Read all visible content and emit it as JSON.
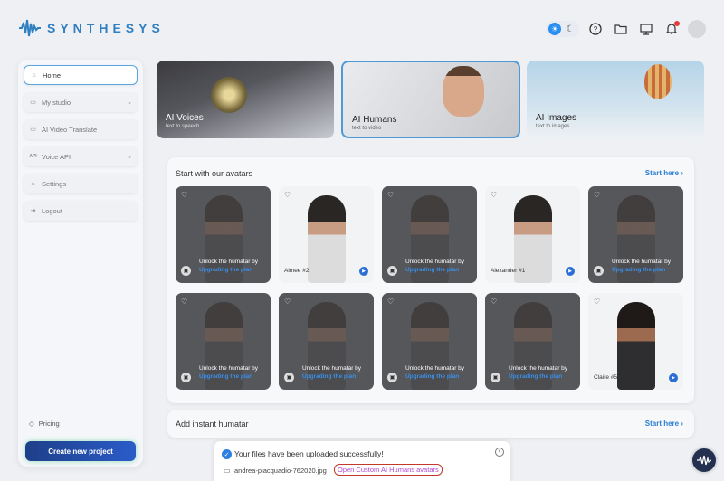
{
  "brand": {
    "name": "SYNTHESYS"
  },
  "header": {
    "icons": [
      "sun-icon",
      "moon-icon",
      "help-icon",
      "folder-icon",
      "presentation-icon",
      "bell-icon",
      "user-avatar"
    ]
  },
  "sidebar": {
    "items": [
      {
        "label": "Home",
        "icon": "home-icon"
      },
      {
        "label": "My studio",
        "icon": "folder-icon"
      },
      {
        "label": "AI Video Translate",
        "icon": "translate-icon"
      },
      {
        "label": "Voice API",
        "icon": "api-icon",
        "badge": "API"
      },
      {
        "label": "Settings",
        "icon": "settings-icon"
      },
      {
        "label": "Logout",
        "icon": "logout-icon"
      }
    ],
    "pricing": "Pricing",
    "create_button": "Create new project"
  },
  "top_cards": [
    {
      "title": "AI Voices",
      "subtitle": "text to speech"
    },
    {
      "title": "AI Humans",
      "subtitle": "text to video"
    },
    {
      "title": "AI Images",
      "subtitle": "text to images"
    }
  ],
  "avatars_panel": {
    "title": "Start with our avatars",
    "start_here": "Start here ›",
    "unlock_line1": "Unlock the humatar by",
    "unlock_line2": "Upgrading the plan",
    "names": {
      "aimee": "Aimee #2",
      "alexander": "Alexander #1",
      "claire": "Claire #5"
    }
  },
  "instant_panel": {
    "title": "Add instant humatar",
    "start_here": "Start here ›"
  },
  "toast": {
    "message": "Your files have been uploaded successfully!",
    "file_name": "andrea-piacquadio-762020.jpg",
    "link": "Open Custom AI Humans avatars",
    "close": "×"
  }
}
